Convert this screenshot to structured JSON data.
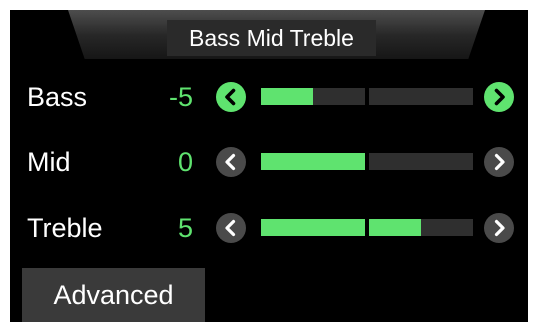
{
  "header": {
    "title": "Bass Mid Treble"
  },
  "colors": {
    "accent": "#5fe36f",
    "background": "#000000",
    "track": "#2f2f2f",
    "button_inactive": "#4a4a4a"
  },
  "rows": [
    {
      "label": "Bass",
      "value": "-5",
      "level": -5,
      "range": [
        -10,
        10
      ],
      "left_button_icon": "chevron-left-icon",
      "right_button_icon": "chevron-right-icon",
      "buttons_highlighted": true
    },
    {
      "label": "Mid",
      "value": "0",
      "level": 0,
      "range": [
        -10,
        10
      ],
      "left_button_icon": "chevron-left-icon",
      "right_button_icon": "chevron-right-icon",
      "buttons_highlighted": false
    },
    {
      "label": "Treble",
      "value": "5",
      "level": 5,
      "range": [
        -10,
        10
      ],
      "left_button_icon": "chevron-left-icon",
      "right_button_icon": "chevron-right-icon",
      "buttons_highlighted": false
    }
  ],
  "advanced_button": {
    "label": "Advanced"
  }
}
